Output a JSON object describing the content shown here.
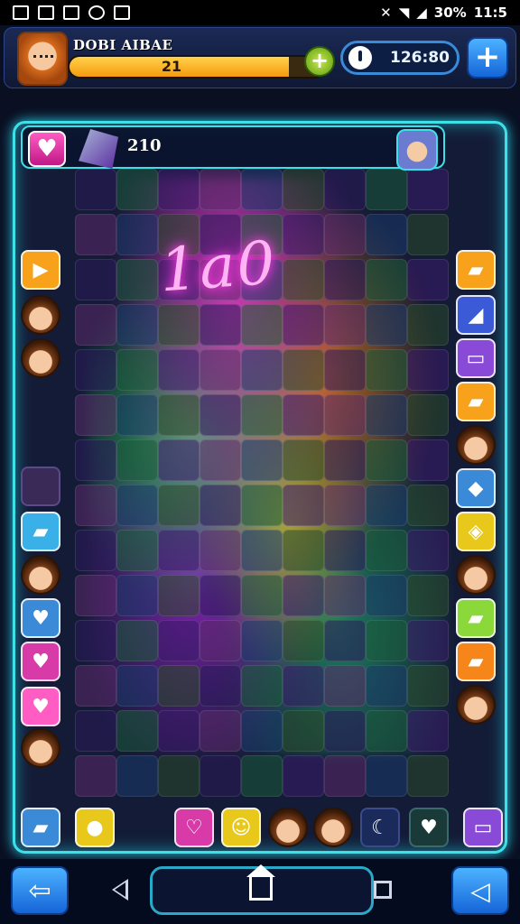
{
  "status_bar": {
    "battery": "30%",
    "time": "11:5"
  },
  "header": {
    "player_name": "DOBI AIBAE",
    "level": "21",
    "progress_fraction": 0.86,
    "timer": "126:80",
    "add_label": "+"
  },
  "board": {
    "title": "1a0",
    "score": "210",
    "heart_symbol": "♥",
    "colors": {
      "frame": "#3ee0e8",
      "pink": "#ff3ae8",
      "green": "#28ff5a",
      "orange": "#ff8c14",
      "yellow": "#ffdc28",
      "purple": "#c828ff"
    }
  },
  "left_column": [
    "arrow-right-icon",
    "avatar",
    "avatar",
    "empty",
    "green-gem-icon",
    "avatar",
    "heart-icon",
    "heart-icon",
    "heart-icon",
    "avatar"
  ],
  "right_column": [
    "green-gem-icon",
    "blue-triangle-icon",
    "yellow-card-icon",
    "red-gem-icon",
    "avatar",
    "blue-diamond-icon",
    "green-gem-icon",
    "avatar",
    "green-gem-icon",
    "orange-gem-icon",
    "avatar"
  ],
  "nav": {
    "left_symbol": "⇦",
    "right_symbol": "◁"
  }
}
